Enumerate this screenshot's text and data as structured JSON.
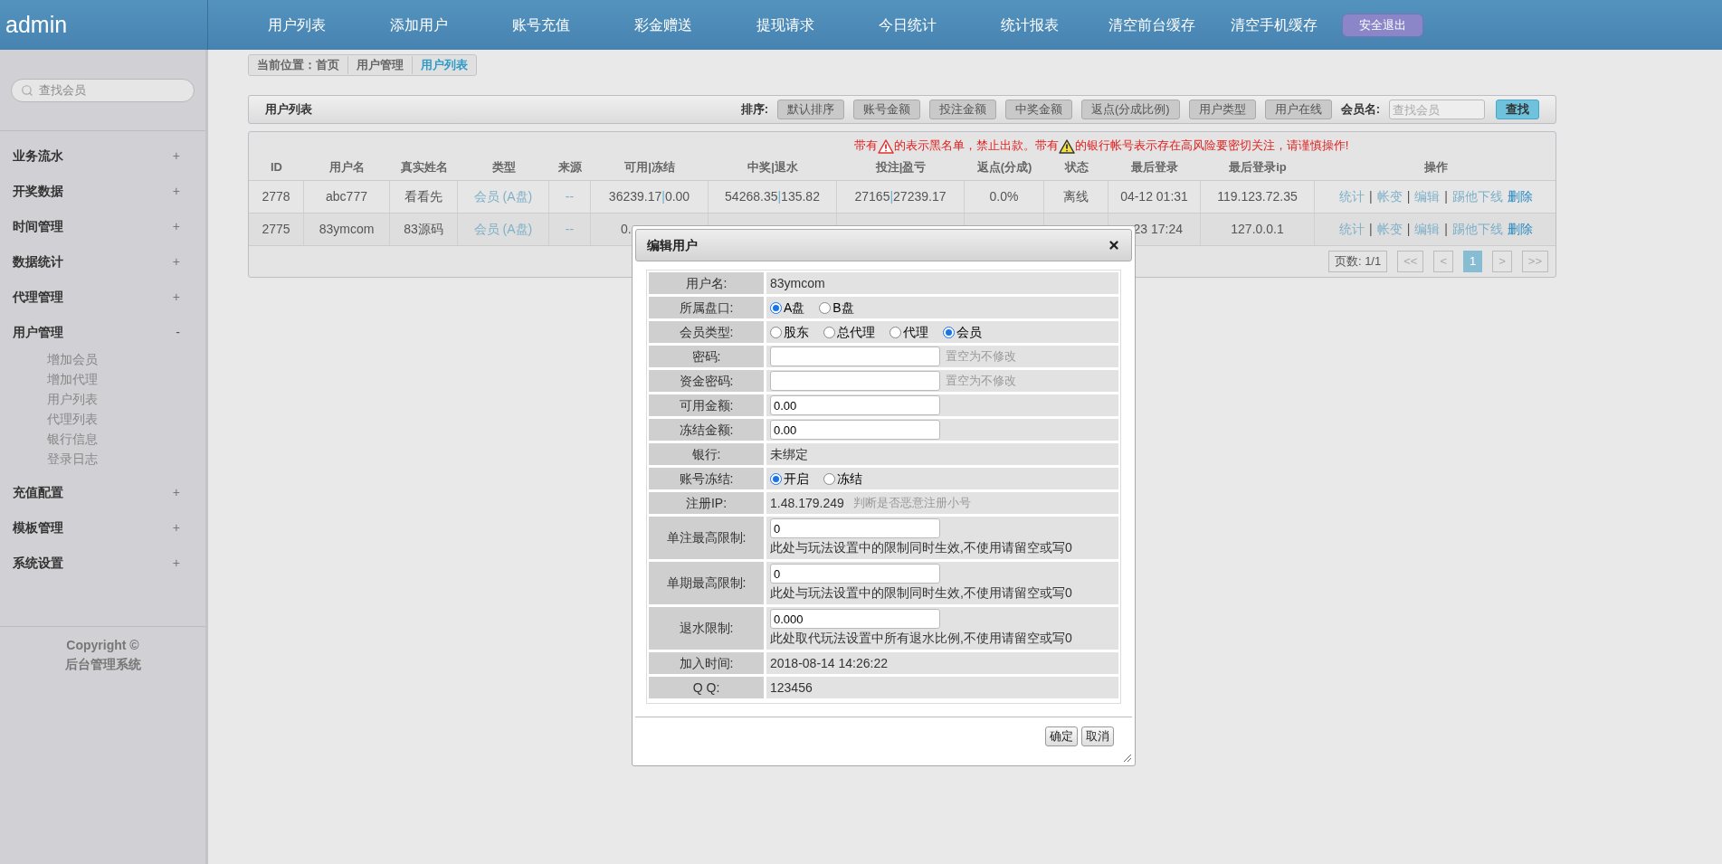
{
  "brand": "admin",
  "nav": [
    "用户列表",
    "添加用户",
    "账号充值",
    "彩金赠送",
    "提现请求",
    "今日统计",
    "统计报表",
    "清空前台缓存",
    "清空手机缓存"
  ],
  "logout": "安全退出",
  "breadcrumb": [
    "当前位置：首页",
    "用户管理",
    "用户列表"
  ],
  "sidebar": {
    "search_placeholder": "查找会员",
    "groups": [
      {
        "label": "业务流水",
        "expanded": false,
        "mark": "+"
      },
      {
        "label": "开奖数据",
        "expanded": false,
        "mark": "+"
      },
      {
        "label": "时间管理",
        "expanded": false,
        "mark": "+"
      },
      {
        "label": "数据统计",
        "expanded": false,
        "mark": "+"
      },
      {
        "label": "代理管理",
        "expanded": false,
        "mark": "+"
      },
      {
        "label": "用户管理",
        "expanded": true,
        "mark": "-",
        "children": [
          "增加会员",
          "增加代理",
          "用户列表",
          "代理列表",
          "银行信息",
          "登录日志"
        ]
      },
      {
        "label": "充值配置",
        "expanded": false,
        "mark": "+"
      },
      {
        "label": "模板管理",
        "expanded": false,
        "mark": "+"
      },
      {
        "label": "系统设置",
        "expanded": false,
        "mark": "+"
      }
    ],
    "copyright": [
      "Copyright ©",
      "后台管理系统"
    ]
  },
  "panel": {
    "title": "用户列表",
    "sort_label": "排序:",
    "sort_buttons": [
      "默认排序",
      "账号金额",
      "投注金额",
      "中奖金额",
      "返点(分成比例)",
      "用户类型",
      "用户在线"
    ],
    "member_label": "会员名:",
    "member_placeholder": "查找会员",
    "search_button": "查找"
  },
  "notice": [
    {
      "kind": "text",
      "text": "带有"
    },
    {
      "kind": "blacklist"
    },
    {
      "kind": "text",
      "text": "的表示黑名单，禁止出款。带有"
    },
    {
      "kind": "risk"
    },
    {
      "kind": "text",
      "text": "的银行帐号表示存在高风险要密切关注，请谨慎操作!"
    }
  ],
  "table": {
    "split_mark": "|",
    "columns": [
      "ID",
      "用户名",
      "真实姓名",
      "类型",
      "来源",
      "可用|冻结",
      "中奖|退水",
      "投注|盈亏",
      "返点(分成)",
      "状态",
      "最后登录",
      "最后登录ip",
      "操作"
    ],
    "rows": [
      {
        "id": "2778",
        "username": "abc777",
        "real_name": "看看先",
        "type": "会员 (A盘)",
        "source": "--",
        "available": [
          "36239.17",
          "0.00"
        ],
        "win": [
          "54268.35",
          "135.82"
        ],
        "bet": [
          "27165",
          "27239.17"
        ],
        "rebate": "0.0%",
        "status": "离线",
        "last_login": "04-12 01:31",
        "ip": "119.123.72.35",
        "actions": [
          {
            "label": "统计",
            "kind": "link",
            "separator": "|"
          },
          {
            "label": "帐变",
            "kind": "link",
            "separator": "|"
          },
          {
            "label": "编辑",
            "kind": "link",
            "separator": "|"
          },
          {
            "label": "踢他下线",
            "kind": "link"
          },
          {
            "label": "删除",
            "kind": "primary"
          }
        ]
      },
      {
        "id": "2775",
        "username": "83ymcom",
        "real_name": "83源码",
        "type": "会员 (A盘)",
        "source": "--",
        "available": [
          "0."
        ],
        "last_login": "23 17:24",
        "ip": "127.0.0.1",
        "actions": [
          {
            "label": "统计",
            "kind": "link",
            "separator": "|"
          },
          {
            "label": "帐变",
            "kind": "link",
            "separator": "|"
          },
          {
            "label": "编辑",
            "kind": "link",
            "separator": "|"
          },
          {
            "label": "踢他下线",
            "kind": "link"
          },
          {
            "label": "删除",
            "kind": "primary"
          }
        ]
      }
    ]
  },
  "pager": {
    "info": "页数: 1/1",
    "buttons": [
      {
        "label": "<<",
        "selected": false
      },
      {
        "label": "<",
        "selected": false
      },
      {
        "label": "1",
        "selected": true
      },
      {
        "label": ">",
        "selected": false
      },
      {
        "label": ">>",
        "selected": false
      }
    ]
  },
  "dialog": {
    "title": "编辑用户",
    "fields": [
      {
        "kind": "text",
        "label": "用户名:",
        "value": "83ymcom"
      },
      {
        "kind": "radio",
        "label": "所属盘口:",
        "options": [
          {
            "label": "A盘",
            "selected": true
          },
          {
            "label": "B盘",
            "selected": false
          }
        ]
      },
      {
        "kind": "radio",
        "label": "会员类型:",
        "options": [
          {
            "label": "股东",
            "selected": false
          },
          {
            "label": "总代理",
            "selected": false
          },
          {
            "label": "代理",
            "selected": false
          },
          {
            "label": "会员",
            "selected": true
          }
        ]
      },
      {
        "kind": "input",
        "label": "密码:",
        "hint": "置空为不修改"
      },
      {
        "kind": "input",
        "label": "资金密码:",
        "hint": "置空为不修改"
      },
      {
        "kind": "input",
        "label": "可用金额:",
        "value": "0.00"
      },
      {
        "kind": "input",
        "label": "冻结金额:",
        "value": "0.00"
      },
      {
        "kind": "text",
        "label": "银行:",
        "value": "未绑定"
      },
      {
        "kind": "radio",
        "label": "账号冻结:",
        "options": [
          {
            "label": "开启",
            "selected": true
          },
          {
            "label": "冻结",
            "selected": false
          }
        ]
      },
      {
        "kind": "text",
        "label": "注册IP:",
        "value": "1.48.179.249",
        "hint": "判断是否恶意注册小号"
      },
      {
        "kind": "input-note",
        "label": "单注最高限制:",
        "value": "0",
        "note": "此处与玩法设置中的限制同时生效,不使用请留空或写0"
      },
      {
        "kind": "input-note",
        "label": "单期最高限制:",
        "value": "0",
        "note": "此处与玩法设置中的限制同时生效,不使用请留空或写0"
      },
      {
        "kind": "input-note",
        "label": "退水限制:",
        "value": "0.000",
        "note": "此处取代玩法设置中所有退水比例,不使用请留空或写0"
      },
      {
        "kind": "text",
        "label": "加入时间:",
        "value": "2018-08-14 14:26:22"
      },
      {
        "kind": "text",
        "label": "Q Q:",
        "value": "123456"
      }
    ],
    "buttons": [
      "确定",
      "取消"
    ]
  }
}
